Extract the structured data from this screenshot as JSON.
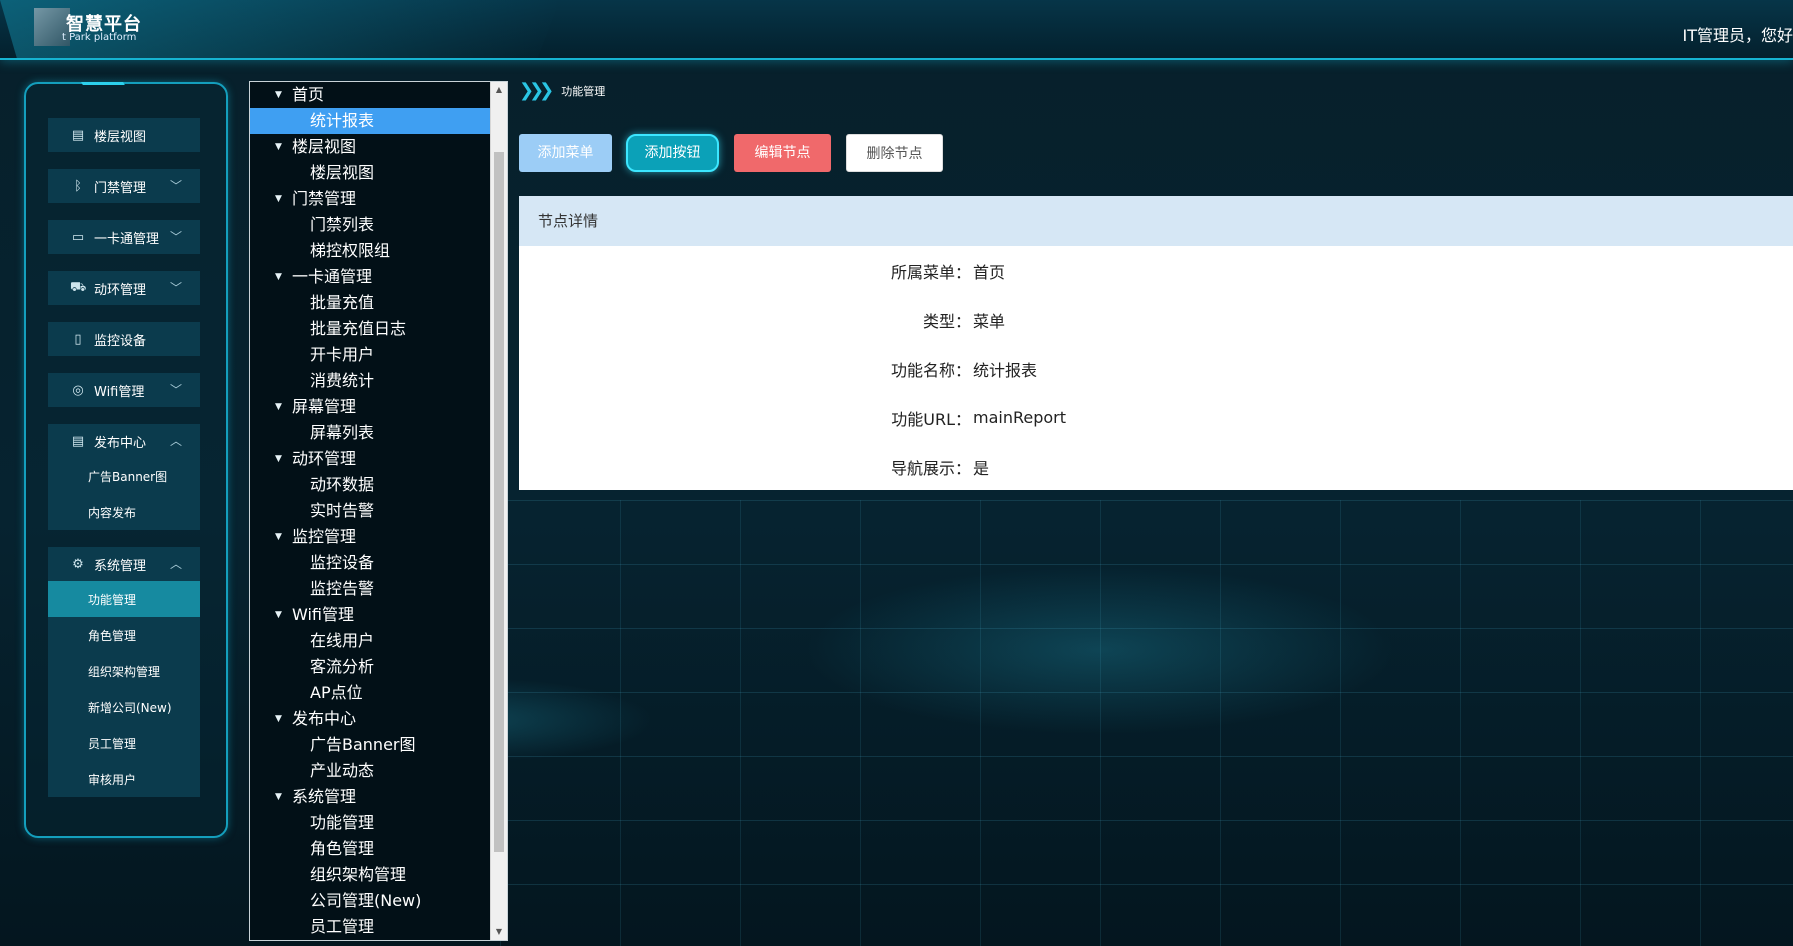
{
  "header": {
    "brand_title": "智慧平台",
    "brand_subtitle": "t Park platform",
    "greeting": "IT管理员，您好"
  },
  "sidebar": {
    "items": [
      {
        "label": "楼层视图",
        "icon": "building-icon",
        "chevron": ""
      },
      {
        "label": "门禁管理",
        "icon": "bluetooth-icon",
        "chevron": "﹀"
      },
      {
        "label": "一卡通管理",
        "icon": "card-reader-icon",
        "chevron": "﹀"
      },
      {
        "label": "动环管理",
        "icon": "car-icon",
        "chevron": "﹀"
      },
      {
        "label": "监控设备",
        "icon": "phone-icon",
        "chevron": ""
      },
      {
        "label": "Wifi管理",
        "icon": "wifi-icon",
        "chevron": "﹀"
      }
    ],
    "publish_group": {
      "label": "发布中心",
      "icon": "document-icon",
      "chevron": "︿",
      "children": [
        "广告Banner图",
        "内容发布"
      ]
    },
    "system_group": {
      "label": "系统管理",
      "icon": "gear-icon",
      "chevron": "︿",
      "children": [
        "功能管理",
        "角色管理",
        "组织架构管理",
        "新增公司(New)",
        "员工管理",
        "审核用户"
      ],
      "active": "功能管理"
    }
  },
  "tree": {
    "rows": [
      {
        "label": "首页",
        "level": 0
      },
      {
        "label": "统计报表",
        "level": 1,
        "selected": true
      },
      {
        "label": "楼层视图",
        "level": 0
      },
      {
        "label": "楼层视图",
        "level": 1
      },
      {
        "label": "门禁管理",
        "level": 0
      },
      {
        "label": "门禁列表",
        "level": 1
      },
      {
        "label": "梯控权限组",
        "level": 1
      },
      {
        "label": "一卡通管理",
        "level": 0
      },
      {
        "label": "批量充值",
        "level": 1
      },
      {
        "label": "批量充值日志",
        "level": 1
      },
      {
        "label": "开卡用户",
        "level": 1
      },
      {
        "label": "消费统计",
        "level": 1
      },
      {
        "label": "屏幕管理",
        "level": 0
      },
      {
        "label": "屏幕列表",
        "level": 1
      },
      {
        "label": "动环管理",
        "level": 0
      },
      {
        "label": "动环数据",
        "level": 1
      },
      {
        "label": "实时告警",
        "level": 1
      },
      {
        "label": "监控管理",
        "level": 0
      },
      {
        "label": "监控设备",
        "level": 1
      },
      {
        "label": "监控告警",
        "level": 1
      },
      {
        "label": "Wifi管理",
        "level": 0
      },
      {
        "label": "在线用户",
        "level": 1
      },
      {
        "label": "客流分析",
        "level": 1
      },
      {
        "label": "AP点位",
        "level": 1
      },
      {
        "label": "发布中心",
        "level": 0
      },
      {
        "label": "广告Banner图",
        "level": 1
      },
      {
        "label": "产业动态",
        "level": 1
      },
      {
        "label": "系统管理",
        "level": 0
      },
      {
        "label": "功能管理",
        "level": 1
      },
      {
        "label": "角色管理",
        "level": 1
      },
      {
        "label": "组织架构管理",
        "level": 1
      },
      {
        "label": "公司管理(New)",
        "level": 1
      },
      {
        "label": "员工管理",
        "level": 1
      }
    ]
  },
  "breadcrumb": {
    "current": "功能管理"
  },
  "toolbar": {
    "add_menu": "添加菜单",
    "add_button": "添加按钮",
    "edit_node": "编辑节点",
    "delete_node": "删除节点"
  },
  "detail": {
    "title": "节点详情",
    "fields": [
      {
        "label": "所属菜单：",
        "value": "首页"
      },
      {
        "label": "类型：",
        "value": "菜单"
      },
      {
        "label": "功能名称：",
        "value": "统计报表"
      },
      {
        "label": "功能URL：",
        "value": "mainReport"
      },
      {
        "label": "导航展示：",
        "value": "是"
      }
    ]
  }
}
